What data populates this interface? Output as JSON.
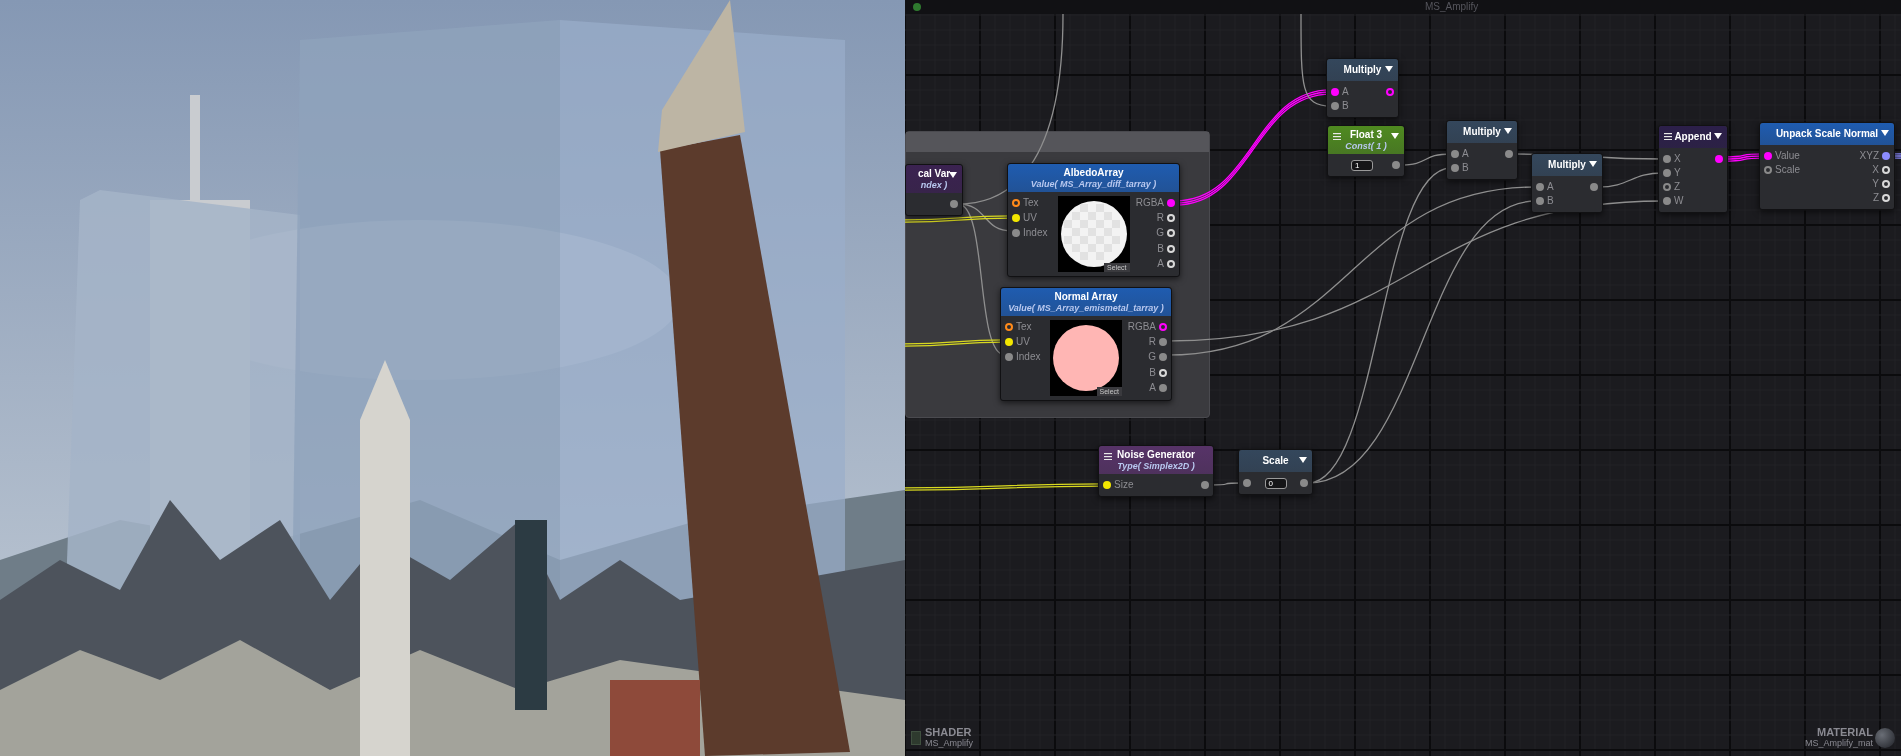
{
  "editor": {
    "title": "MS_Amplify"
  },
  "group_frame": {
    "kind": "comment"
  },
  "nodes": [
    {
      "title": "cal Var",
      "subtitle": "ndex )",
      "color": "#3b2251",
      "menu": false,
      "dropdown": true,
      "rows": [
        {
          "out": {
            "color": "#8a8a8a",
            "hollow": false
          }
        }
      ]
    },
    {
      "title": "AlbedoArray",
      "subtitle": "Value( MS_Array_diff_tarray )",
      "color": "#1f5cb0",
      "menu": false,
      "dropdown": false,
      "preview": {
        "color": "#f3f3f3",
        "checker": true,
        "button": "Select"
      },
      "rows": [
        {
          "in": {
            "label": "Tex",
            "color": "#ff8a1a",
            "hollow": true
          },
          "out": {
            "label": "RGBA",
            "color": "#ff00ff",
            "hollow": false
          }
        },
        {
          "in": {
            "label": "UV",
            "color": "#f2e600",
            "hollow": false
          },
          "out": {
            "label": "R",
            "color": "#d8d8d8",
            "hollow": true
          }
        },
        {
          "in": {
            "label": "Index",
            "color": "#8a8a8a",
            "hollow": false
          },
          "out": {
            "label": "G",
            "color": "#d8d8d8",
            "hollow": true
          }
        },
        {
          "out": {
            "label": "B",
            "color": "#d8d8d8",
            "hollow": true
          }
        },
        {
          "out": {
            "label": "A",
            "color": "#d8d8d8",
            "hollow": true
          }
        }
      ]
    },
    {
      "title": "Normal Array",
      "subtitle": "Value( MS_Array_emismetal_tarray )",
      "color": "#1f5cb0",
      "menu": false,
      "dropdown": false,
      "preview": {
        "color": "#ffb6b4",
        "checker": false,
        "button": "Select"
      },
      "rows": [
        {
          "in": {
            "label": "Tex",
            "color": "#ff8a1a",
            "hollow": true
          },
          "out": {
            "label": "RGBA",
            "color": "#ff00ff",
            "hollow": true
          }
        },
        {
          "in": {
            "label": "UV",
            "color": "#f2e600",
            "hollow": false
          },
          "out": {
            "label": "R",
            "color": "#8a8a8a",
            "hollow": false
          }
        },
        {
          "in": {
            "label": "Index",
            "color": "#8a8a8a",
            "hollow": false
          },
          "out": {
            "label": "G",
            "color": "#8a8a8a",
            "hollow": false
          }
        },
        {
          "out": {
            "label": "B",
            "color": "#d8d8d8",
            "hollow": true
          }
        },
        {
          "out": {
            "label": "A",
            "color": "#8a8a8a",
            "hollow": false
          }
        }
      ]
    },
    {
      "title": "Multiply",
      "color": "#34475c",
      "menu": false,
      "dropdown": true,
      "rows": [
        {
          "in": {
            "label": "A",
            "color": "#ff00ff",
            "hollow": false
          },
          "out": {
            "color": "#ff00ff",
            "hollow": true
          }
        },
        {
          "in": {
            "label": "B",
            "color": "#8a8a8a",
            "hollow": false
          }
        }
      ]
    },
    {
      "title": "Float 3",
      "subtitle": "Const( 1 )",
      "color": "#4f8a20",
      "menu": true,
      "dropdown": true,
      "rows": [
        {
          "field": "1",
          "out": {
            "color": "#8a8a8a",
            "hollow": false
          }
        }
      ]
    },
    {
      "title": "Multiply",
      "color": "#34475c",
      "menu": false,
      "dropdown": true,
      "rows": [
        {
          "in": {
            "label": "A",
            "color": "#8a8a8a",
            "hollow": false
          },
          "out": {
            "color": "#8a8a8a",
            "hollow": false
          }
        },
        {
          "in": {
            "label": "B",
            "color": "#8a8a8a",
            "hollow": false
          }
        }
      ]
    },
    {
      "title": "Multiply",
      "color": "#34475c",
      "menu": false,
      "dropdown": true,
      "rows": [
        {
          "in": {
            "label": "A",
            "color": "#8a8a8a",
            "hollow": false
          },
          "out": {
            "color": "#8a8a8a",
            "hollow": false
          }
        },
        {
          "in": {
            "label": "B",
            "color": "#8a8a8a",
            "hollow": false
          }
        }
      ]
    },
    {
      "title": "Append",
      "color": "#2c1f4a",
      "menu": true,
      "dropdown": true,
      "rows": [
        {
          "in": {
            "label": "X",
            "color": "#8a8a8a",
            "hollow": false
          },
          "out": {
            "color": "#ff00ff",
            "hollow": false
          }
        },
        {
          "in": {
            "label": "Y",
            "color": "#8a8a8a",
            "hollow": false
          }
        },
        {
          "in": {
            "label": "Z",
            "color": "#8a8a8a",
            "hollow": true
          }
        },
        {
          "in": {
            "label": "W",
            "color": "#8a8a8a",
            "hollow": false
          }
        }
      ]
    },
    {
      "title": "Unpack Scale Normal",
      "color": "#1f5cb0",
      "menu": false,
      "dropdown": true,
      "rows": [
        {
          "in": {
            "label": "Value",
            "color": "#ff00ff",
            "hollow": false
          },
          "out": {
            "label": "XYZ",
            "color": "#8c8cff",
            "hollow": false
          }
        },
        {
          "in": {
            "label": "Scale",
            "color": "#8a8a8a",
            "hollow": true
          },
          "out": {
            "label": "X",
            "color": "#d8d8d8",
            "hollow": true
          }
        },
        {
          "out": {
            "label": "Y",
            "color": "#d8d8d8",
            "hollow": true
          }
        },
        {
          "out": {
            "label": "Z",
            "color": "#d8d8d8",
            "hollow": true
          }
        }
      ]
    },
    {
      "title": "Noise Generator",
      "subtitle": "Type( Simplex2D )",
      "color": "#573368",
      "menu": true,
      "dropdown": false,
      "rows": [
        {
          "in": {
            "label": "Size",
            "color": "#f2e600",
            "hollow": false
          },
          "out": {
            "color": "#8a8a8a",
            "hollow": false
          }
        }
      ]
    },
    {
      "title": "Scale",
      "color": "#34475c",
      "menu": false,
      "dropdown": true,
      "rows": [
        {
          "in": {
            "color": "#8a8a8a",
            "hollow": false
          },
          "field": "0",
          "out": {
            "color": "#8a8a8a",
            "hollow": false
          }
        }
      ]
    }
  ],
  "shader": {
    "label": "SHADER",
    "name": "MS_Amplify"
  },
  "material": {
    "label": "MATERIAL",
    "name": "MS_Amplify_mat"
  }
}
